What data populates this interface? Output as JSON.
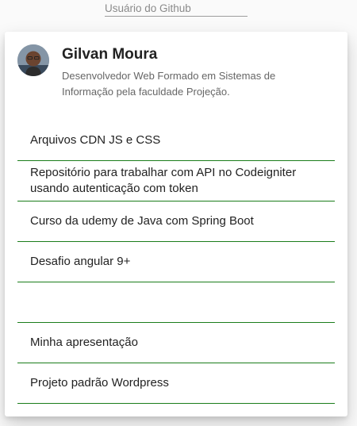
{
  "search": {
    "placeholder": "Usuário do Github"
  },
  "profile": {
    "name": "Gilvan Moura",
    "bio": "Desenvolvedor Web Formado em Sistemas de Informação pela faculdade Projeção."
  },
  "repos": [
    {
      "name": "Arquivos CDN JS e CSS"
    },
    {
      "name": "Repositório para trabalhar com API no Codeigniter usando autenticação com token"
    },
    {
      "name": "Curso da udemy de Java com Spring Boot"
    },
    {
      "name": "Desafio angular 9+"
    },
    {
      "name": ""
    },
    {
      "name": "Minha apresentação"
    },
    {
      "name": "Projeto padrão Wordpress"
    }
  ],
  "colors": {
    "divider": "#1b7d1b",
    "card_bg": "#ffffff",
    "page_bg": "#fafafa"
  }
}
